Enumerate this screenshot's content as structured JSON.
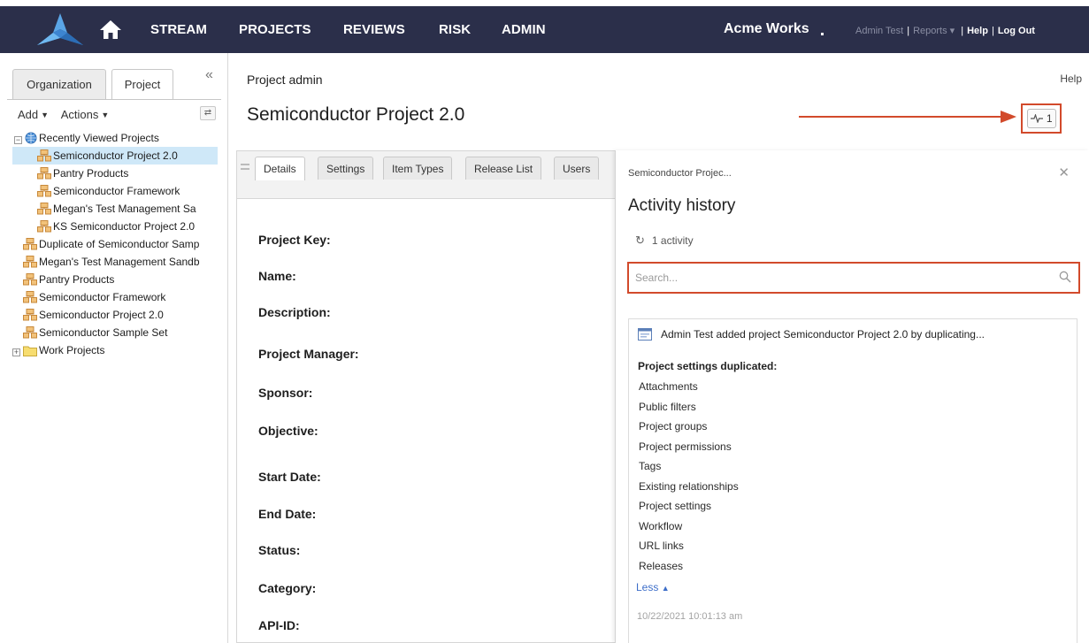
{
  "nav": {
    "items": [
      "STREAM",
      "PROJECTS",
      "REVIEWS",
      "RISK",
      "ADMIN"
    ],
    "brand": "Acme Works",
    "util": {
      "user": "Admin Test",
      "reports": "Reports",
      "help": "Help",
      "logout": "Log Out"
    }
  },
  "left": {
    "tab_org": "Organization",
    "tab_project": "Project",
    "add_label": "Add",
    "actions_label": "Actions",
    "tree": [
      {
        "label": "Recently Viewed Projects",
        "kind": "globe",
        "expander": "−"
      },
      {
        "label": "Semiconductor Project 2.0",
        "kind": "project",
        "selected": true
      },
      {
        "label": "Pantry Products",
        "kind": "project"
      },
      {
        "label": "Semiconductor Framework",
        "kind": "project"
      },
      {
        "label": "Megan's Test Management Sa",
        "kind": "project"
      },
      {
        "label": "KS Semiconductor Project 2.0",
        "kind": "project"
      },
      {
        "label": "Duplicate of Semiconductor Samp",
        "kind": "project"
      },
      {
        "label": "Megan's Test Management Sandb",
        "kind": "project"
      },
      {
        "label": "Pantry Products",
        "kind": "project"
      },
      {
        "label": "Semiconductor Framework",
        "kind": "project"
      },
      {
        "label": "Semiconductor Project 2.0",
        "kind": "project"
      },
      {
        "label": "Semiconductor Sample Set",
        "kind": "project"
      },
      {
        "label": "Work Projects",
        "kind": "folder",
        "expander": "+"
      }
    ]
  },
  "main": {
    "breadcrumb": "Project admin",
    "help": "Help",
    "title": "Semiconductor Project 2.0",
    "activity_count_button": "1",
    "tabs": [
      "Details",
      "Settings",
      "Item Types",
      "Release List",
      "Users"
    ],
    "fields": [
      "Project Key:",
      "Name:",
      "Description:",
      "Project Manager:",
      "Sponsor:",
      "Objective:",
      "Start Date:",
      "End Date:",
      "Status:",
      "Category:",
      "API-ID:"
    ]
  },
  "activity": {
    "breadcrumb": "Semiconductor Projec...",
    "title": "Activity history",
    "count": "1 activity",
    "search_placeholder": "Search...",
    "entry": {
      "headline": "Admin Test added project Semiconductor Project 2.0 by duplicating...",
      "subtitle": "Project settings duplicated:",
      "items": [
        "Attachments",
        "Public filters",
        "Project groups",
        "Project permissions",
        "Tags",
        "Existing relationships",
        "Project settings",
        "Workflow",
        "URL links",
        "Releases"
      ],
      "less": "Less",
      "timestamp": "10/22/2021 10:01:13 am"
    }
  },
  "colors": {
    "nav_bg": "#2b2f4a",
    "highlight": "#d24a2b",
    "selected_row": "#cfe8f8",
    "link": "#3d6ec9"
  }
}
